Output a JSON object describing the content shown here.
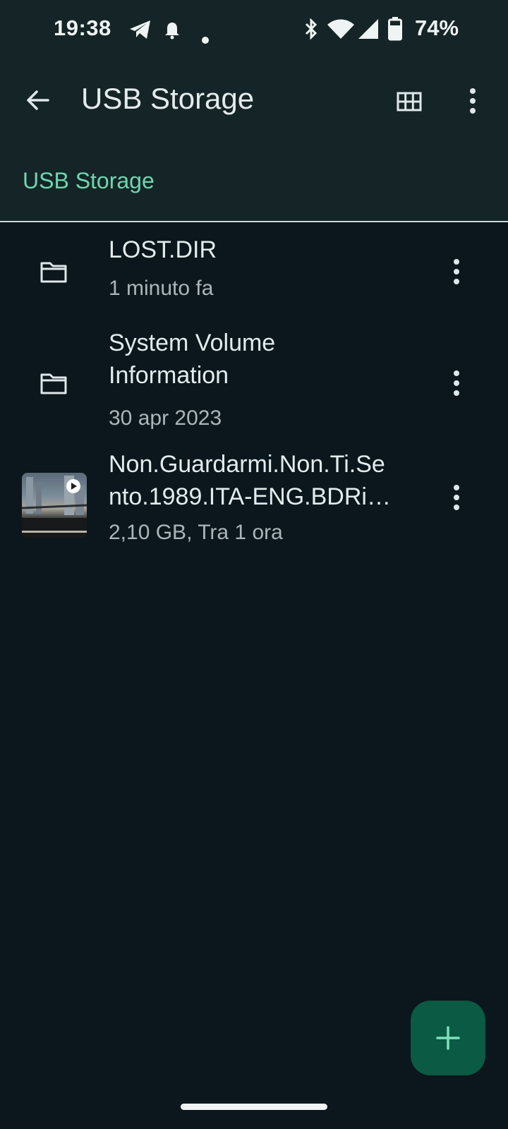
{
  "status_bar": {
    "time": "19:38",
    "battery": "74%",
    "icons": [
      "telegram-icon",
      "notification-bell-icon",
      "dot-icon",
      "bluetooth-icon",
      "wifi-icon",
      "cellular-signal-icon",
      "battery-icon"
    ]
  },
  "app_bar": {
    "title": "USB Storage",
    "actions": [
      "grid-view-icon",
      "more-options-icon"
    ]
  },
  "breadcrumb": {
    "label": "USB Storage"
  },
  "files": [
    {
      "name_lines": [
        "LOST.DIR"
      ],
      "meta": "1 minuto fa",
      "type": "folder"
    },
    {
      "name_lines": [
        "System Volume",
        "Information"
      ],
      "meta": "30 apr 2023",
      "type": "folder"
    },
    {
      "name_lines": [
        "Non.Guardarmi.Non.Ti.Se",
        "nto.1989.ITA-ENG.BDRi…"
      ],
      "meta": "2,10 GB, Tra 1 ora",
      "type": "video"
    }
  ],
  "fab": {
    "icon": "plus-icon"
  },
  "colors": {
    "accent": "#6dd6b0",
    "fab": "#0b5a43",
    "header_bg": "#152426",
    "body_bg": "#0b171c"
  }
}
